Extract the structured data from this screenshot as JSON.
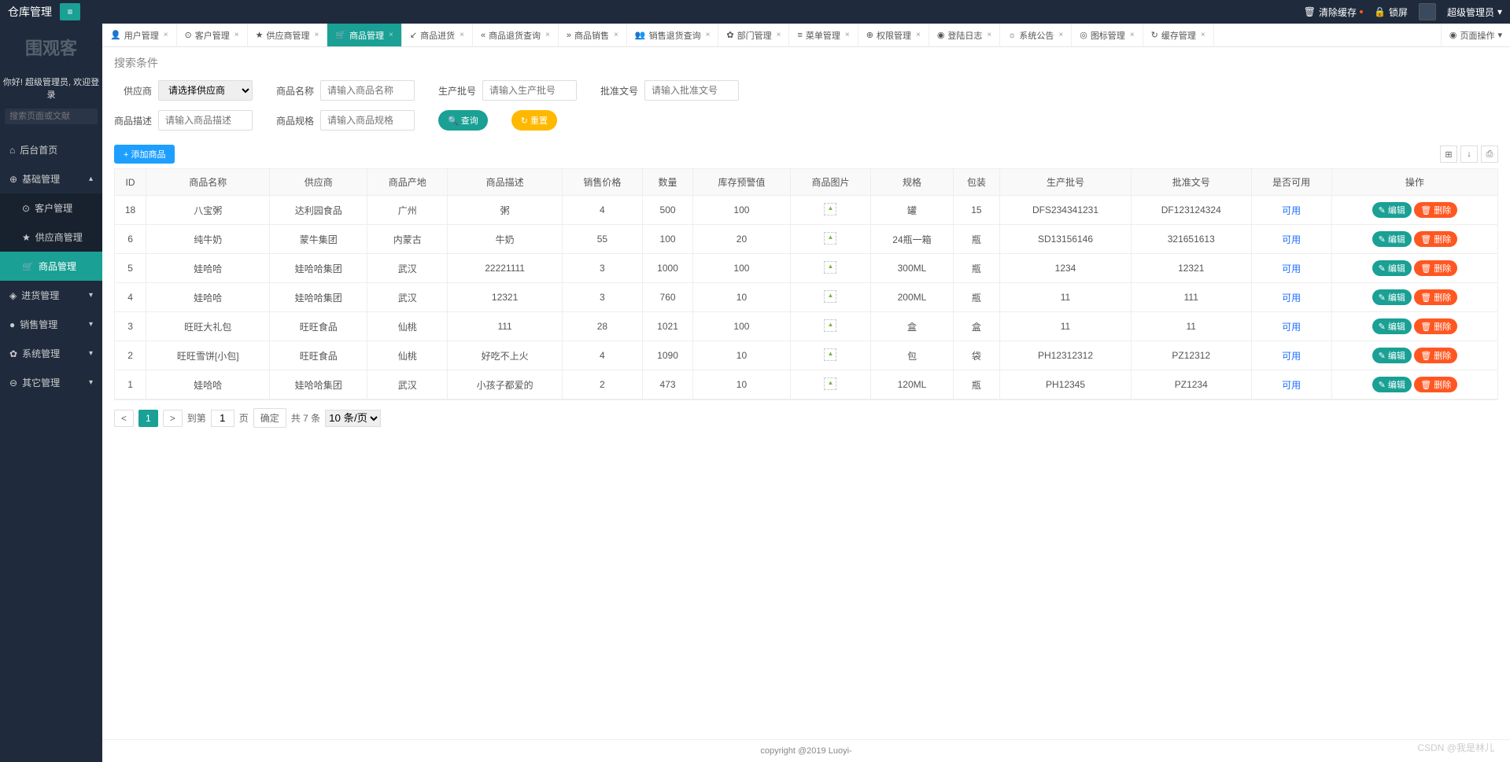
{
  "header": {
    "app_title": "仓库管理",
    "clear_cache": "清除缓存",
    "lock_screen": "锁屏",
    "user_name": "超级管理员"
  },
  "sidebar": {
    "logo": "围观客",
    "welcome": "你好! 超级管理员, 欢迎登录",
    "search_placeholder": "搜索页面或文献",
    "items": [
      {
        "label": "后台首页",
        "icon": "⌂"
      },
      {
        "label": "基础管理",
        "icon": "⊕",
        "expanded": true
      },
      {
        "label": "客户管理",
        "icon": "⊙",
        "sub": true
      },
      {
        "label": "供应商管理",
        "icon": "★",
        "sub": true
      },
      {
        "label": "商品管理",
        "icon": "🛒",
        "sub": true,
        "active": true
      },
      {
        "label": "进货管理",
        "icon": "◈",
        "arrow": true
      },
      {
        "label": "销售管理",
        "icon": "●",
        "arrow": true
      },
      {
        "label": "系统管理",
        "icon": "✿",
        "arrow": true
      },
      {
        "label": "其它管理",
        "icon": "⊖",
        "arrow": true
      }
    ]
  },
  "tabs": [
    {
      "label": "用户管理",
      "icon": "👤"
    },
    {
      "label": "客户管理",
      "icon": "⊙"
    },
    {
      "label": "供应商管理",
      "icon": "★"
    },
    {
      "label": "商品管理",
      "icon": "🛒",
      "active": true
    },
    {
      "label": "商品进货",
      "icon": "↙"
    },
    {
      "label": "商品退货查询",
      "icon": "«"
    },
    {
      "label": "商品销售",
      "icon": "»"
    },
    {
      "label": "销售退货查询",
      "icon": "👥"
    },
    {
      "label": "部门管理",
      "icon": "✿"
    },
    {
      "label": "菜单管理",
      "icon": "≡"
    },
    {
      "label": "权限管理",
      "icon": "⊕"
    },
    {
      "label": "登陆日志",
      "icon": "◉"
    },
    {
      "label": "系统公告",
      "icon": "☼"
    },
    {
      "label": "图标管理",
      "icon": "◎"
    },
    {
      "label": "缓存管理",
      "icon": "↻"
    }
  ],
  "tab_ops": "页面操作",
  "search": {
    "title": "搜索条件",
    "supplier_label": "供应商",
    "supplier_placeholder": "请选择供应商",
    "name_label": "商品名称",
    "name_placeholder": "请输入商品名称",
    "batch_label": "生产批号",
    "batch_placeholder": "请输入生产批号",
    "approval_label": "批准文号",
    "approval_placeholder": "请输入批准文号",
    "desc_label": "商品描述",
    "desc_placeholder": "请输入商品描述",
    "spec_label": "商品规格",
    "spec_placeholder": "请输入商品规格",
    "btn_search": "查询",
    "btn_reset": "重置"
  },
  "toolbar": {
    "add_btn": "+ 添加商品"
  },
  "table": {
    "headers": [
      "ID",
      "商品名称",
      "供应商",
      "商品产地",
      "商品描述",
      "销售价格",
      "数量",
      "库存预警值",
      "商品图片",
      "规格",
      "包装",
      "生产批号",
      "批准文号",
      "是否可用",
      "操作"
    ],
    "rows": [
      {
        "id": "18",
        "name": "八宝粥",
        "supplier": "达利园食品",
        "origin": "广州",
        "desc": "粥",
        "price": "4",
        "qty": "500",
        "warn": "100",
        "spec": "罐",
        "pack": "15",
        "batch": "DFS234341231",
        "approval": "DF123124324",
        "available": "可用"
      },
      {
        "id": "6",
        "name": "纯牛奶",
        "supplier": "蒙牛集团",
        "origin": "内蒙古",
        "desc": "牛奶",
        "price": "55",
        "qty": "100",
        "warn": "20",
        "spec": "24瓶一箱",
        "pack": "瓶",
        "batch": "SD13156146",
        "approval": "321651613",
        "available": "可用"
      },
      {
        "id": "5",
        "name": "娃哈哈",
        "supplier": "娃哈哈集团",
        "origin": "武汉",
        "desc": "22221111",
        "price": "3",
        "qty": "1000",
        "warn": "100",
        "spec": "300ML",
        "pack": "瓶",
        "batch": "1234",
        "approval": "12321",
        "available": "可用"
      },
      {
        "id": "4",
        "name": "娃哈哈",
        "supplier": "娃哈哈集团",
        "origin": "武汉",
        "desc": "12321",
        "price": "3",
        "qty": "760",
        "warn": "10",
        "spec": "200ML",
        "pack": "瓶",
        "batch": "11",
        "approval": "111",
        "available": "可用"
      },
      {
        "id": "3",
        "name": "旺旺大礼包",
        "supplier": "旺旺食品",
        "origin": "仙桃",
        "desc": "111",
        "price": "28",
        "qty": "1021",
        "warn": "100",
        "spec": "盒",
        "pack": "盒",
        "batch": "11",
        "approval": "11",
        "available": "可用"
      },
      {
        "id": "2",
        "name": "旺旺雪饼[小包]",
        "supplier": "旺旺食品",
        "origin": "仙桃",
        "desc": "好吃不上火",
        "price": "4",
        "qty": "1090",
        "warn": "10",
        "spec": "包",
        "pack": "袋",
        "batch": "PH12312312",
        "approval": "PZ12312",
        "available": "可用"
      },
      {
        "id": "1",
        "name": "娃哈哈",
        "supplier": "娃哈哈集团",
        "origin": "武汉",
        "desc": "小孩子都爱的",
        "price": "2",
        "qty": "473",
        "warn": "10",
        "spec": "120ML",
        "pack": "瓶",
        "batch": "PH12345",
        "approval": "PZ1234",
        "available": "可用"
      }
    ],
    "edit_label": "编辑",
    "delete_label": "删除"
  },
  "pager": {
    "page": "1",
    "to_label": "到第",
    "page_input": "1",
    "page_unit": "页",
    "confirm": "确定",
    "total": "共 7 条",
    "per_page": "10 条/页"
  },
  "footer": "copyright @2019 Luoyi-",
  "watermark": "CSDN @我是林儿"
}
